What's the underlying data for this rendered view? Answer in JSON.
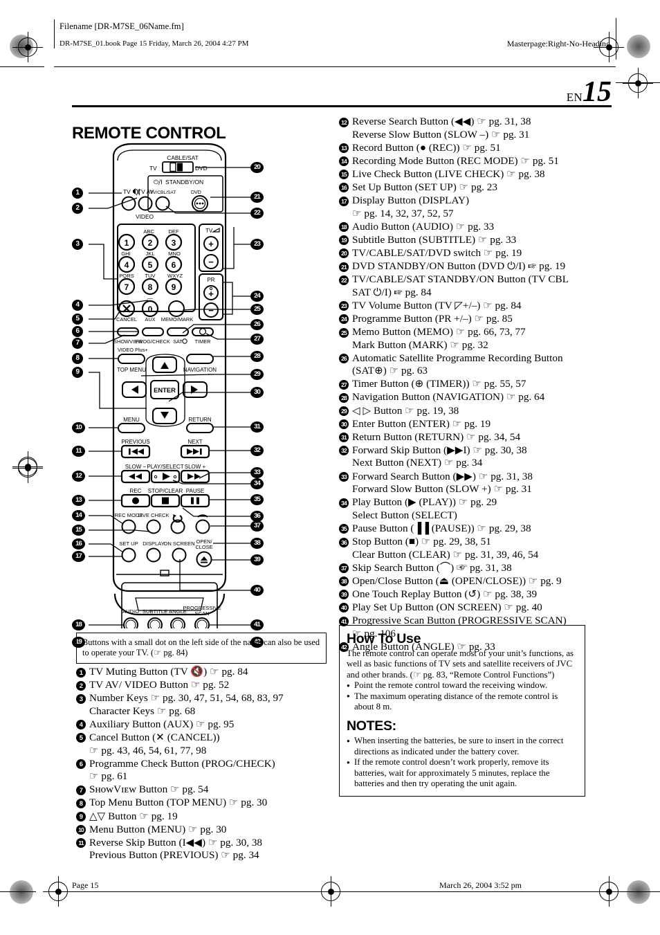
{
  "printer_marks": {
    "filename_label": "Filename [DR-M7SE_06Name.fm]",
    "book_line": "DR-M7SE_01.book  Page 15  Friday, March 26, 2004  4:27 PM",
    "masterpage": "Masterpage:Right-No-Heading"
  },
  "header": {
    "lang": "EN",
    "page_number": "15",
    "section_title": "REMOTE CONTROL"
  },
  "footer": {
    "left": "Page 15",
    "right": "March 26, 2004 3:52 pm"
  },
  "tv_note": "Buttons with a small dot on the left side of the name can also be used to operate your TV. (☞ pg. 84)",
  "left_list": [
    {
      "n": "1",
      "lines": [
        "TV Muting Button (TV 🔇) ☞ pg. 84"
      ]
    },
    {
      "n": "2",
      "lines": [
        "TV AV/  VIDEO Button ☞ pg. 52"
      ]
    },
    {
      "n": "3",
      "lines": [
        "Number Keys ☞ pg. 30, 47, 51, 54, 68, 83, 97",
        "Character Keys ☞ pg. 68"
      ]
    },
    {
      "n": "4",
      "lines": [
        "Auxiliary Button (AUX) ☞ pg. 95"
      ]
    },
    {
      "n": "5",
      "lines": [
        "Cancel Button (✕ (CANCEL))",
        "☞ pg. 43, 46, 54, 61, 77, 98"
      ]
    },
    {
      "n": "6",
      "lines": [
        "Programme Check Button (PROG/CHECK)",
        "☞ pg. 61"
      ]
    },
    {
      "n": "7",
      "lines": [
        "SʜᴏᴡVɪᴇᴡ Button ☞ pg. 54"
      ]
    },
    {
      "n": "8",
      "lines": [
        "Top Menu Button (TOP MENU) ☞ pg. 30"
      ]
    },
    {
      "n": "9",
      "lines": [
        "△▽ Button ☞ pg. 19"
      ]
    },
    {
      "n": "10",
      "lines": [
        "Menu Button (MENU) ☞ pg. 30"
      ]
    },
    {
      "n": "11",
      "lines": [
        "Reverse Skip Button (I◀◀) ☞ pg. 30, 38",
        "Previous Button (PREVIOUS) ☞ pg. 34"
      ]
    }
  ],
  "right_list": [
    {
      "n": "12",
      "lines": [
        "Reverse Search Button (◀◀) ☞ pg. 31, 38",
        "Reverse Slow Button (SLOW –) ☞ pg. 31"
      ]
    },
    {
      "n": "13",
      "lines": [
        "Record Button (● (REC)) ☞ pg. 51"
      ]
    },
    {
      "n": "14",
      "lines": [
        "Recording Mode Button (REC MODE) ☞ pg. 51"
      ]
    },
    {
      "n": "15",
      "lines": [
        "Live Check Button (LIVE CHECK) ☞ pg. 38"
      ]
    },
    {
      "n": "16",
      "lines": [
        "Set Up Button (SET UP) ☞ pg. 23"
      ]
    },
    {
      "n": "17",
      "lines": [
        "Display Button (DISPLAY)",
        "☞ pg. 14, 32, 37, 52, 57"
      ]
    },
    {
      "n": "18",
      "lines": [
        "Audio Button (AUDIO) ☞ pg. 33"
      ]
    },
    {
      "n": "19",
      "lines": [
        "Subtitle Button (SUBTITLE) ☞ pg. 33"
      ]
    },
    {
      "n": "20",
      "lines": [
        "TV/CABLE/SAT/DVD switch ☞ pg. 19"
      ]
    },
    {
      "n": "21",
      "lines": [
        "DVD STANDBY/ON Button (DVD ⏻/I) ☞ pg. 19"
      ]
    },
    {
      "n": "22",
      "lines": [
        "TV/CABLE/SAT STANDBY/ON Button (TV CBL",
        "SAT ⏻/I) ☞ pg. 84"
      ]
    },
    {
      "n": "23",
      "lines": [
        "TV Volume Button (TV ◸+/–) ☞ pg. 84"
      ]
    },
    {
      "n": "24",
      "lines": [
        "Programme Button (PR +/–) ☞ pg. 85"
      ]
    },
    {
      "n": "25",
      "lines": [
        "Memo Button (MEMO) ☞ pg. 66, 73, 77",
        "Mark Button (MARK) ☞ pg. 32"
      ]
    },
    {
      "n": "26",
      "lines": [
        "Automatic Satellite Programme Recording Button",
        "(SAT⊕) ☞ pg. 63"
      ]
    },
    {
      "n": "27",
      "lines": [
        "Timer Button (⊕ (TIMER)) ☞ pg. 55, 57"
      ]
    },
    {
      "n": "28",
      "lines": [
        "Navigation Button (NAVIGATION) ☞ pg. 64"
      ]
    },
    {
      "n": "29",
      "lines": [
        "◁ ▷ Button ☞ pg. 19, 38"
      ]
    },
    {
      "n": "30",
      "lines": [
        "Enter Button (ENTER) ☞ pg. 19"
      ]
    },
    {
      "n": "31",
      "lines": [
        "Return Button (RETURN) ☞ pg. 34, 54"
      ]
    },
    {
      "n": "32",
      "lines": [
        "Forward Skip Button (▶▶I) ☞ pg. 30, 38",
        "Next Button (NEXT) ☞ pg. 34"
      ]
    },
    {
      "n": "33",
      "lines": [
        "Forward Search Button (▶▶) ☞ pg. 31, 38",
        "Forward Slow Button (SLOW +) ☞ pg. 31"
      ]
    },
    {
      "n": "34",
      "lines": [
        "Play Button (▶ (PLAY)) ☞ pg. 29",
        "Select Button (SELECT)"
      ]
    },
    {
      "n": "35",
      "lines": [
        "Pause Button (▐▐ (PAUSE)) ☞ pg. 29, 38"
      ]
    },
    {
      "n": "36",
      "lines": [
        "Stop Button (■) ☞ pg. 29, 38, 51",
        "Clear Button (CLEAR) ☞ pg. 31, 39, 46, 54"
      ]
    },
    {
      "n": "37",
      "lines": [
        "Skip Search Button (⌒) ☞ pg. 31, 38"
      ]
    },
    {
      "n": "38",
      "lines": [
        "Open/Close Button (⏏ (OPEN/CLOSE)) ☞ pg. 9"
      ]
    },
    {
      "n": "39",
      "lines": [
        "One Touch Replay Button (↺) ☞ pg. 38, 39"
      ]
    },
    {
      "n": "40",
      "lines": [
        "Play Set Up Button (ON SCREEN) ☞ pg. 40"
      ]
    },
    {
      "n": "41",
      "lines": [
        "Progressive Scan Button (PROGRESSIVE SCAN)",
        "☞ pg. 106"
      ]
    },
    {
      "n": "42",
      "lines": [
        "Angle Button (ANGLE) ☞ pg. 33"
      ]
    }
  ],
  "how_to_use": {
    "title": "How To Use",
    "body": "The remote control can operate most of your unit’s functions, as well as basic functions of TV sets and satellite receivers of JVC and other brands. (☞ pg. 83, “Remote Control Functions”)",
    "bullets": [
      "Point the remote control toward the receiving window.",
      "The maximum operating distance of the remote control is about 8 m."
    ],
    "notes_title": "NOTES:",
    "notes": [
      "When inserting the batteries, be sure to insert in the correct directions as indicated under the battery cover.",
      "If the remote control doesn’t work properly, remove its batteries, wait for approximately 5 minutes, replace the batteries and then try operating the unit again."
    ]
  },
  "remote_diagram": {
    "labels": {
      "cable_sat": "CABLE/SAT",
      "tv": "TV",
      "dvd": "DVD",
      "standby_on": "STANDBY/ON",
      "standby_glyph": "⏻/I",
      "tv_cbl_sat": "TV/CBL/SAT",
      "dvd_small": "DVD",
      "tv_mute": "TV",
      "tv_av": "TV AV",
      "video": "VIDEO",
      "abc": "ABC",
      "def": "DEF",
      "ghi": "GHI",
      "jkl": "JKL",
      "mno": "MNO",
      "pqrs": "PQRS",
      "tuv": "TUV",
      "wxyz": "WXYZ",
      "k1": "1",
      "k2": "2",
      "k3": "3",
      "k4": "4",
      "k5": "5",
      "k6": "6",
      "k7": "7",
      "k8": "8",
      "k9": "9",
      "k0": "0",
      "tv_vol": "TV",
      "pr": "PR",
      "plus": "+",
      "minus": "−",
      "cancel": "CANCEL",
      "aux": "AUX",
      "memo_mark": "MEMO/MARK",
      "showview": "SHOWVIEW",
      "video_plus": "VIDEO Plus+",
      "prog_check": "PROG/CHECK",
      "sat": "SAT",
      "timer": "TIMER",
      "top_menu": "TOP MENU",
      "navigation": "NAVIGATION",
      "enter": "ENTER",
      "menu": "MENU",
      "return": "RETURN",
      "previous": "PREVIOUS",
      "next": "NEXT",
      "slow_minus": "SLOW −",
      "play_select": "PLAY/SELECT",
      "slow_plus": "SLOW +",
      "rec": "REC",
      "stop_clear": "STOP/CLEAR",
      "pause": "PAUSE",
      "rec_mode": "REC MODE",
      "live_check": "LIVE CHECK",
      "set_up": "SET UP",
      "display": "DISPLAY",
      "on_screen": "ON SCREEN",
      "open_close": "OPEN/ CLOSE",
      "audio": "AUDIO",
      "subtitle": "SUBTITLE",
      "angle": "ANGLE",
      "progressive_scan": "PROGRESSIVE SCAN"
    },
    "callouts_left": [
      "1",
      "2",
      "3",
      "4",
      "5",
      "6",
      "7",
      "8",
      "9",
      "10",
      "11",
      "12",
      "13",
      "14",
      "15",
      "16",
      "17",
      "18",
      "19"
    ],
    "callouts_right": [
      "20",
      "21",
      "22",
      "23",
      "24",
      "25",
      "26",
      "27",
      "28",
      "29",
      "30",
      "31",
      "32",
      "33",
      "34",
      "35",
      "36",
      "37",
      "38",
      "39",
      "40",
      "41",
      "42"
    ]
  }
}
